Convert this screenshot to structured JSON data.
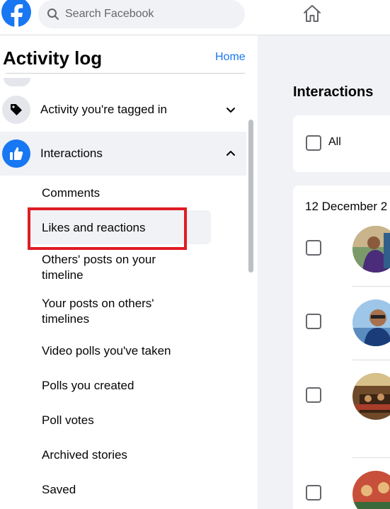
{
  "search": {
    "placeholder": "Search Facebook"
  },
  "sidebar": {
    "title": "Activity log",
    "home_link": "Home",
    "sections": [
      {
        "label": "Activity you're tagged in",
        "icon": "tag-icon",
        "expanded": false
      },
      {
        "label": "Interactions",
        "icon": "thumbs-up-icon",
        "expanded": true
      }
    ],
    "sub_items": [
      {
        "label": "Comments"
      },
      {
        "label": "Likes and reactions"
      },
      {
        "label": "Others' posts on your timeline"
      },
      {
        "label": "Your posts on others' timelines"
      },
      {
        "label": "Video polls you've taken"
      },
      {
        "label": "Polls you created"
      },
      {
        "label": "Poll votes"
      },
      {
        "label": "Archived stories"
      },
      {
        "label": "Saved"
      }
    ]
  },
  "main": {
    "title": "Interactions",
    "select_all_label": "All",
    "date_heading": "12 December 2"
  },
  "colors": {
    "brand": "#1877f2",
    "highlight": "#e01b24",
    "panel_bg": "#f0f2f5"
  }
}
